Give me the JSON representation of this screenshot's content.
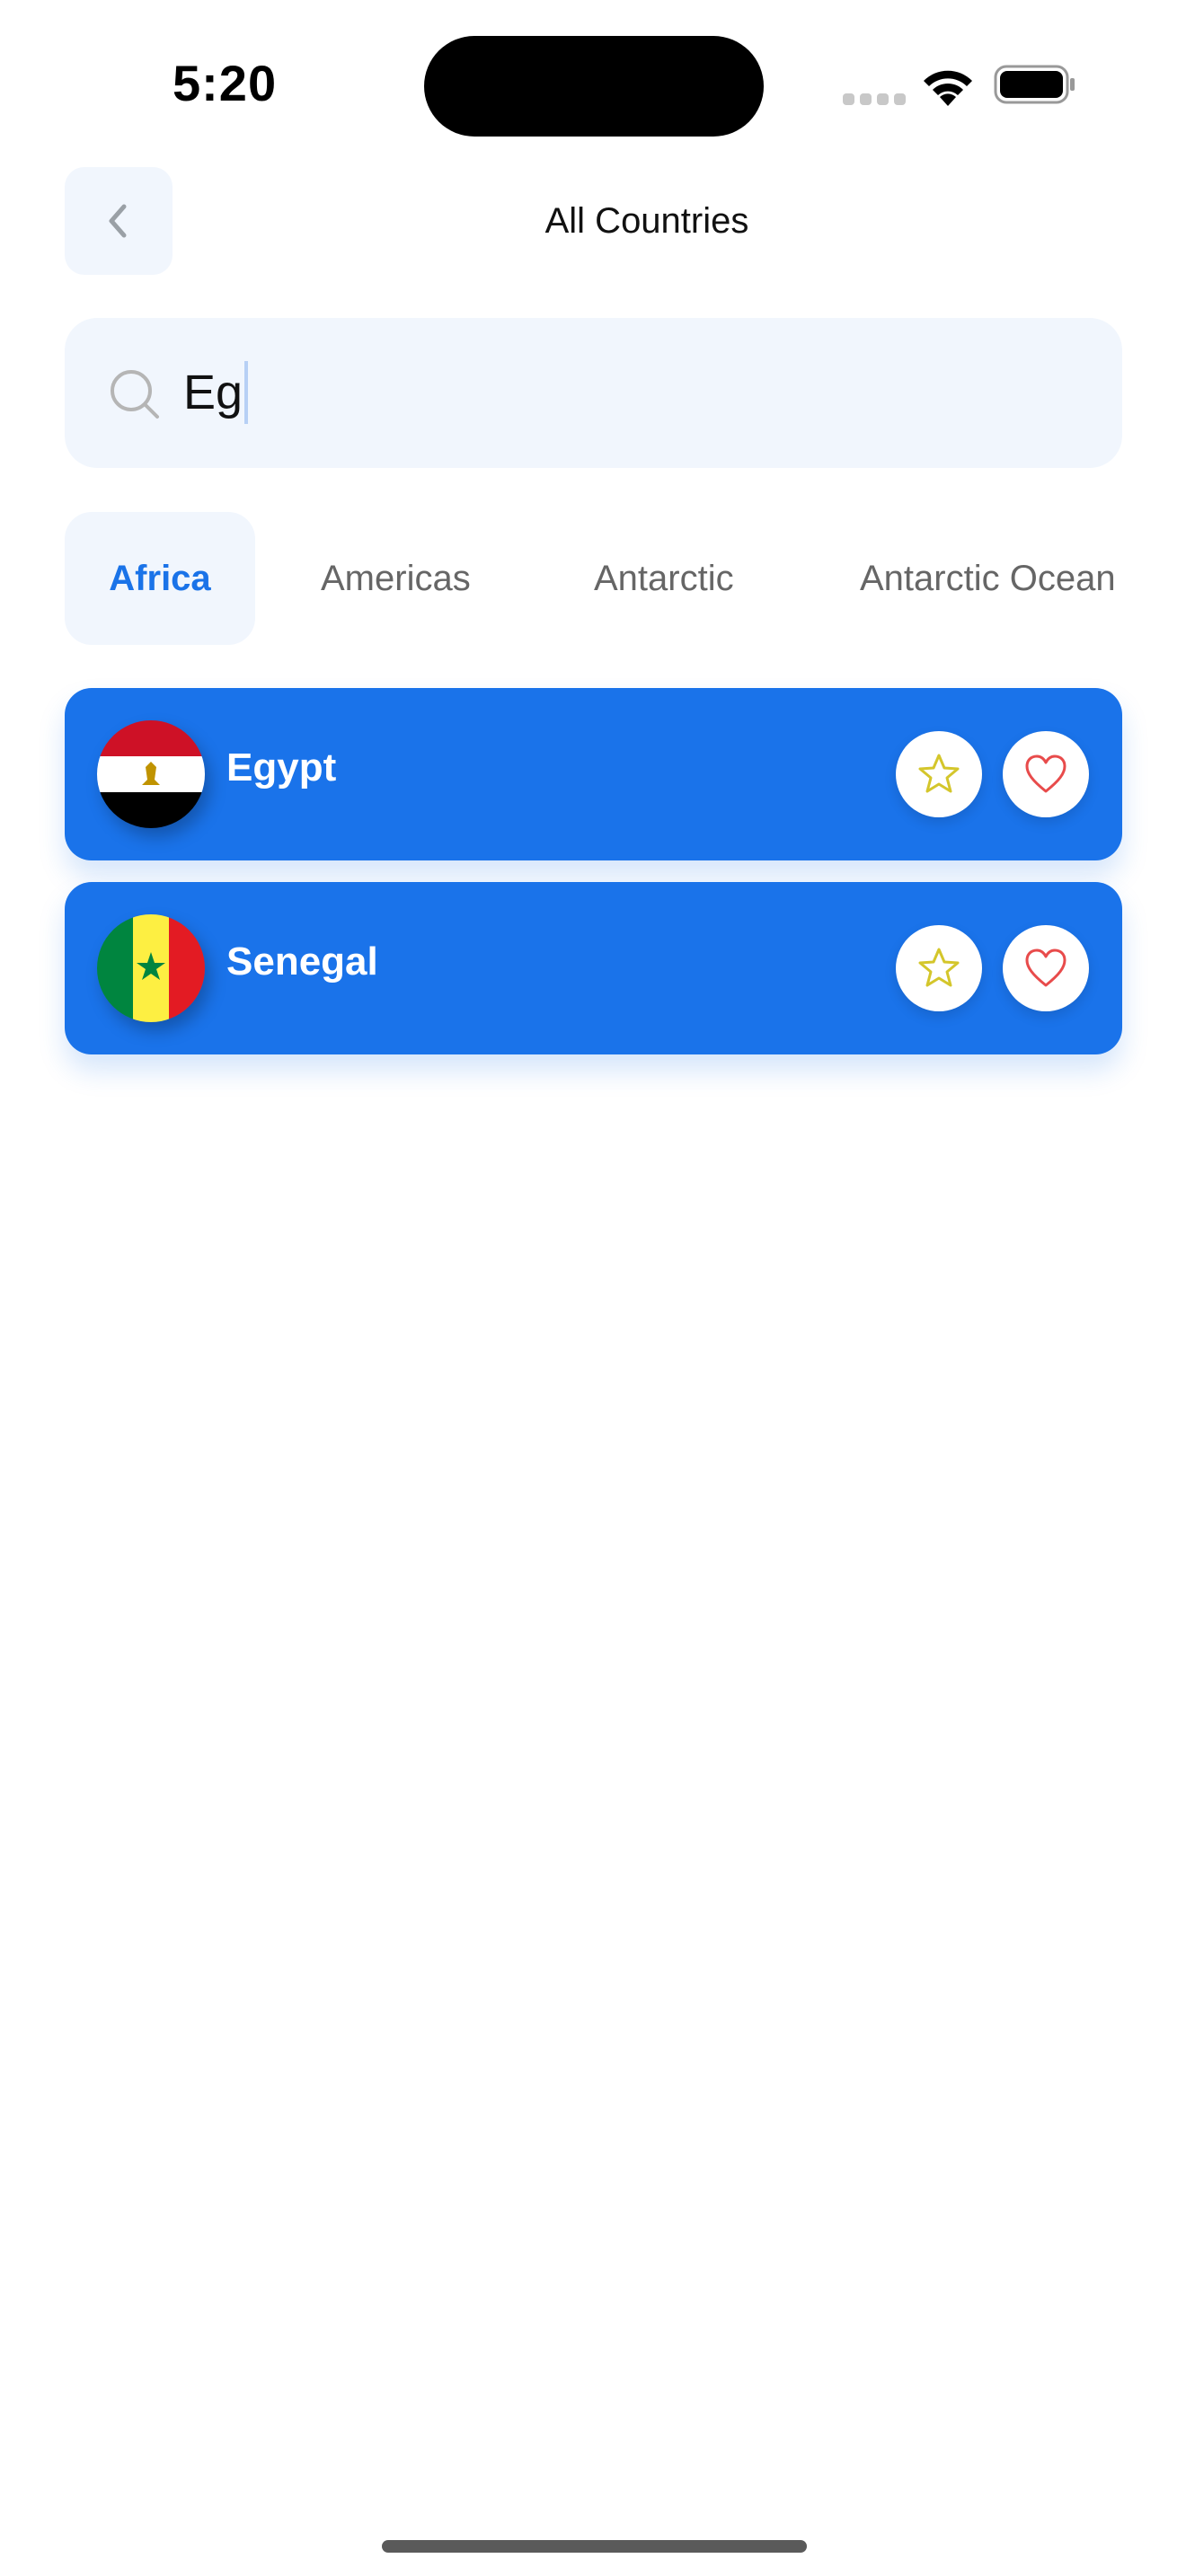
{
  "status_bar": {
    "time": "5:20"
  },
  "header": {
    "title": "All Countries"
  },
  "search": {
    "value": "Eg"
  },
  "tabs": [
    {
      "label": "Africa",
      "active": true
    },
    {
      "label": "Americas",
      "active": false
    },
    {
      "label": "Antarctic",
      "active": false
    },
    {
      "label": "Antarctic Ocean",
      "active": false
    }
  ],
  "countries": [
    {
      "name": "Egypt",
      "flag_icon": "egypt-flag-icon"
    },
    {
      "name": "Senegal",
      "flag_icon": "senegal-flag-icon"
    }
  ],
  "colors": {
    "accent": "#1a73ea",
    "card_bg": "#1a73ea",
    "chip_bg": "#f1f6fd",
    "star": "#d4c62b",
    "heart": "#e84b4b"
  }
}
